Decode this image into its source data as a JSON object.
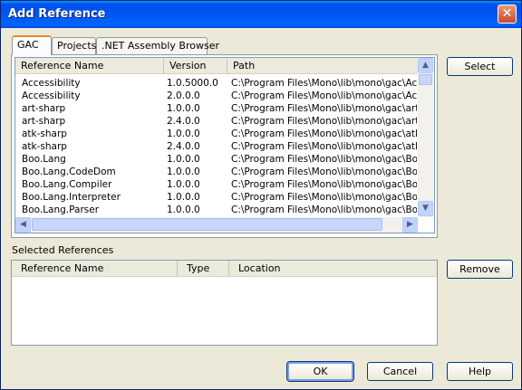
{
  "window": {
    "title": "Add Reference",
    "close_glyph": "✕"
  },
  "tabs": [
    {
      "label": "GAC",
      "active": true
    },
    {
      "label": "Projects",
      "active": false
    },
    {
      "label": ".NET Assembly Browser",
      "active": false
    }
  ],
  "gac_list": {
    "columns": [
      "Reference Name",
      "Version",
      "Path"
    ],
    "rows": [
      [
        "Accessibility",
        "1.0.5000.0",
        "C:\\Program Files\\Mono\\lib\\mono\\gac\\Acce"
      ],
      [
        "Accessibility",
        "2.0.0.0",
        "C:\\Program Files\\Mono\\lib\\mono\\gac\\Acce"
      ],
      [
        "art-sharp",
        "1.0.0.0",
        "C:\\Program Files\\Mono\\lib\\mono\\gac\\art-sh"
      ],
      [
        "art-sharp",
        "2.4.0.0",
        "C:\\Program Files\\Mono\\lib\\mono\\gac\\art-sh"
      ],
      [
        "atk-sharp",
        "1.0.0.0",
        "C:\\Program Files\\Mono\\lib\\mono\\gac\\atk-s"
      ],
      [
        "atk-sharp",
        "2.4.0.0",
        "C:\\Program Files\\Mono\\lib\\mono\\gac\\atk-s"
      ],
      [
        "Boo.Lang",
        "1.0.0.0",
        "C:\\Program Files\\Mono\\lib\\mono\\gac\\Boo."
      ],
      [
        "Boo.Lang.CodeDom",
        "1.0.0.0",
        "C:\\Program Files\\Mono\\lib\\mono\\gac\\Boo."
      ],
      [
        "Boo.Lang.Compiler",
        "1.0.0.0",
        "C:\\Program Files\\Mono\\lib\\mono\\gac\\Boo."
      ],
      [
        "Boo.Lang.Interpreter",
        "1.0.0.0",
        "C:\\Program Files\\Mono\\lib\\mono\\gac\\Boo."
      ],
      [
        "Boo.Lang.Parser",
        "1.0.0.0",
        "C:\\Program Files\\Mono\\lib\\mono\\gac\\Boo."
      ]
    ]
  },
  "selected_references": {
    "label": "Selected References",
    "columns": [
      "Reference Name",
      "Type",
      "Location"
    ],
    "rows": []
  },
  "buttons": {
    "select": {
      "label": "Select"
    },
    "remove": {
      "label": "Remove"
    },
    "ok": "OK",
    "cancel": "Cancel",
    "help": {
      "label": "Help"
    }
  },
  "icons": {
    "scroll_up": "▲",
    "scroll_down": "▼",
    "scroll_left": "◀",
    "scroll_right": "▶"
  }
}
